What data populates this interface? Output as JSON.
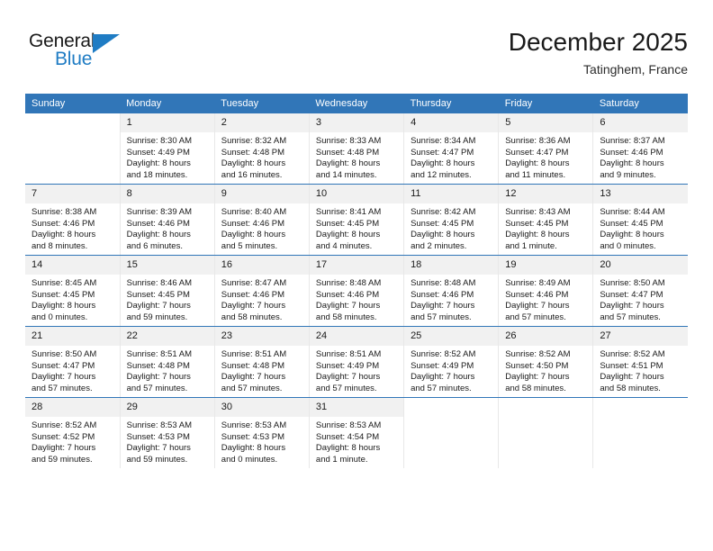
{
  "brand": {
    "name_top": "General",
    "name_bottom": "Blue",
    "accent_color": "#1f7cc4",
    "flag_icon": "brand-flag-triangle"
  },
  "header": {
    "title": "December 2025",
    "subtitle": "Tatinghem, France"
  },
  "colors": {
    "header_row_bg": "#3176b8",
    "daynum_bg": "#f1f1f1",
    "row_separator": "#3176b8",
    "text": "#1a1a1a"
  },
  "calendar": {
    "weekday_headers": [
      "Sunday",
      "Monday",
      "Tuesday",
      "Wednesday",
      "Thursday",
      "Friday",
      "Saturday"
    ],
    "weeks": [
      [
        {
          "day": "",
          "sunrise": "",
          "sunset": "",
          "daylight_line1": "",
          "daylight_line2": ""
        },
        {
          "day": "1",
          "sunrise": "Sunrise: 8:30 AM",
          "sunset": "Sunset: 4:49 PM",
          "daylight_line1": "Daylight: 8 hours",
          "daylight_line2": "and 18 minutes."
        },
        {
          "day": "2",
          "sunrise": "Sunrise: 8:32 AM",
          "sunset": "Sunset: 4:48 PM",
          "daylight_line1": "Daylight: 8 hours",
          "daylight_line2": "and 16 minutes."
        },
        {
          "day": "3",
          "sunrise": "Sunrise: 8:33 AM",
          "sunset": "Sunset: 4:48 PM",
          "daylight_line1": "Daylight: 8 hours",
          "daylight_line2": "and 14 minutes."
        },
        {
          "day": "4",
          "sunrise": "Sunrise: 8:34 AM",
          "sunset": "Sunset: 4:47 PM",
          "daylight_line1": "Daylight: 8 hours",
          "daylight_line2": "and 12 minutes."
        },
        {
          "day": "5",
          "sunrise": "Sunrise: 8:36 AM",
          "sunset": "Sunset: 4:47 PM",
          "daylight_line1": "Daylight: 8 hours",
          "daylight_line2": "and 11 minutes."
        },
        {
          "day": "6",
          "sunrise": "Sunrise: 8:37 AM",
          "sunset": "Sunset: 4:46 PM",
          "daylight_line1": "Daylight: 8 hours",
          "daylight_line2": "and 9 minutes."
        }
      ],
      [
        {
          "day": "7",
          "sunrise": "Sunrise: 8:38 AM",
          "sunset": "Sunset: 4:46 PM",
          "daylight_line1": "Daylight: 8 hours",
          "daylight_line2": "and 8 minutes."
        },
        {
          "day": "8",
          "sunrise": "Sunrise: 8:39 AM",
          "sunset": "Sunset: 4:46 PM",
          "daylight_line1": "Daylight: 8 hours",
          "daylight_line2": "and 6 minutes."
        },
        {
          "day": "9",
          "sunrise": "Sunrise: 8:40 AM",
          "sunset": "Sunset: 4:46 PM",
          "daylight_line1": "Daylight: 8 hours",
          "daylight_line2": "and 5 minutes."
        },
        {
          "day": "10",
          "sunrise": "Sunrise: 8:41 AM",
          "sunset": "Sunset: 4:45 PM",
          "daylight_line1": "Daylight: 8 hours",
          "daylight_line2": "and 4 minutes."
        },
        {
          "day": "11",
          "sunrise": "Sunrise: 8:42 AM",
          "sunset": "Sunset: 4:45 PM",
          "daylight_line1": "Daylight: 8 hours",
          "daylight_line2": "and 2 minutes."
        },
        {
          "day": "12",
          "sunrise": "Sunrise: 8:43 AM",
          "sunset": "Sunset: 4:45 PM",
          "daylight_line1": "Daylight: 8 hours",
          "daylight_line2": "and 1 minute."
        },
        {
          "day": "13",
          "sunrise": "Sunrise: 8:44 AM",
          "sunset": "Sunset: 4:45 PM",
          "daylight_line1": "Daylight: 8 hours",
          "daylight_line2": "and 0 minutes."
        }
      ],
      [
        {
          "day": "14",
          "sunrise": "Sunrise: 8:45 AM",
          "sunset": "Sunset: 4:45 PM",
          "daylight_line1": "Daylight: 8 hours",
          "daylight_line2": "and 0 minutes."
        },
        {
          "day": "15",
          "sunrise": "Sunrise: 8:46 AM",
          "sunset": "Sunset: 4:45 PM",
          "daylight_line1": "Daylight: 7 hours",
          "daylight_line2": "and 59 minutes."
        },
        {
          "day": "16",
          "sunrise": "Sunrise: 8:47 AM",
          "sunset": "Sunset: 4:46 PM",
          "daylight_line1": "Daylight: 7 hours",
          "daylight_line2": "and 58 minutes."
        },
        {
          "day": "17",
          "sunrise": "Sunrise: 8:48 AM",
          "sunset": "Sunset: 4:46 PM",
          "daylight_line1": "Daylight: 7 hours",
          "daylight_line2": "and 58 minutes."
        },
        {
          "day": "18",
          "sunrise": "Sunrise: 8:48 AM",
          "sunset": "Sunset: 4:46 PM",
          "daylight_line1": "Daylight: 7 hours",
          "daylight_line2": "and 57 minutes."
        },
        {
          "day": "19",
          "sunrise": "Sunrise: 8:49 AM",
          "sunset": "Sunset: 4:46 PM",
          "daylight_line1": "Daylight: 7 hours",
          "daylight_line2": "and 57 minutes."
        },
        {
          "day": "20",
          "sunrise": "Sunrise: 8:50 AM",
          "sunset": "Sunset: 4:47 PM",
          "daylight_line1": "Daylight: 7 hours",
          "daylight_line2": "and 57 minutes."
        }
      ],
      [
        {
          "day": "21",
          "sunrise": "Sunrise: 8:50 AM",
          "sunset": "Sunset: 4:47 PM",
          "daylight_line1": "Daylight: 7 hours",
          "daylight_line2": "and 57 minutes."
        },
        {
          "day": "22",
          "sunrise": "Sunrise: 8:51 AM",
          "sunset": "Sunset: 4:48 PM",
          "daylight_line1": "Daylight: 7 hours",
          "daylight_line2": "and 57 minutes."
        },
        {
          "day": "23",
          "sunrise": "Sunrise: 8:51 AM",
          "sunset": "Sunset: 4:48 PM",
          "daylight_line1": "Daylight: 7 hours",
          "daylight_line2": "and 57 minutes."
        },
        {
          "day": "24",
          "sunrise": "Sunrise: 8:51 AM",
          "sunset": "Sunset: 4:49 PM",
          "daylight_line1": "Daylight: 7 hours",
          "daylight_line2": "and 57 minutes."
        },
        {
          "day": "25",
          "sunrise": "Sunrise: 8:52 AM",
          "sunset": "Sunset: 4:49 PM",
          "daylight_line1": "Daylight: 7 hours",
          "daylight_line2": "and 57 minutes."
        },
        {
          "day": "26",
          "sunrise": "Sunrise: 8:52 AM",
          "sunset": "Sunset: 4:50 PM",
          "daylight_line1": "Daylight: 7 hours",
          "daylight_line2": "and 58 minutes."
        },
        {
          "day": "27",
          "sunrise": "Sunrise: 8:52 AM",
          "sunset": "Sunset: 4:51 PM",
          "daylight_line1": "Daylight: 7 hours",
          "daylight_line2": "and 58 minutes."
        }
      ],
      [
        {
          "day": "28",
          "sunrise": "Sunrise: 8:52 AM",
          "sunset": "Sunset: 4:52 PM",
          "daylight_line1": "Daylight: 7 hours",
          "daylight_line2": "and 59 minutes."
        },
        {
          "day": "29",
          "sunrise": "Sunrise: 8:53 AM",
          "sunset": "Sunset: 4:53 PM",
          "daylight_line1": "Daylight: 7 hours",
          "daylight_line2": "and 59 minutes."
        },
        {
          "day": "30",
          "sunrise": "Sunrise: 8:53 AM",
          "sunset": "Sunset: 4:53 PM",
          "daylight_line1": "Daylight: 8 hours",
          "daylight_line2": "and 0 minutes."
        },
        {
          "day": "31",
          "sunrise": "Sunrise: 8:53 AM",
          "sunset": "Sunset: 4:54 PM",
          "daylight_line1": "Daylight: 8 hours",
          "daylight_line2": "and 1 minute."
        },
        {
          "day": "",
          "sunrise": "",
          "sunset": "",
          "daylight_line1": "",
          "daylight_line2": ""
        },
        {
          "day": "",
          "sunrise": "",
          "sunset": "",
          "daylight_line1": "",
          "daylight_line2": ""
        },
        {
          "day": "",
          "sunrise": "",
          "sunset": "",
          "daylight_line1": "",
          "daylight_line2": ""
        }
      ]
    ]
  }
}
